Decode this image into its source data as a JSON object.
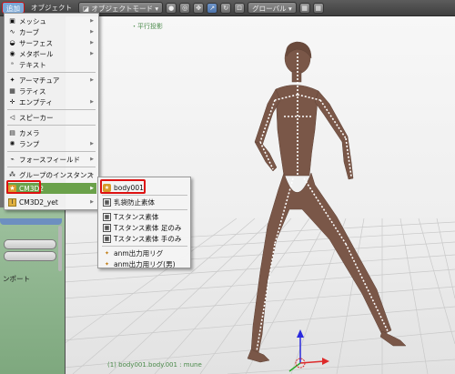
{
  "header": {
    "add_menu": "追加",
    "object_menu": "オブジェクト",
    "mode_select": "オブジェクトモード",
    "orientation_select": "グローバル"
  },
  "viewport": {
    "label": "・平行投影",
    "footer": "(1) body001.body.001 : mune",
    "colors": {
      "background": "#efefef",
      "grid": "#c8c8c8",
      "body": "#7a5748",
      "bone": "#ffffff"
    }
  },
  "shelf": {
    "partial_label": "ンポート"
  },
  "add_menu": {
    "items": [
      {
        "label": "メッシュ",
        "icon": "mesh-icon",
        "submenu": true
      },
      {
        "label": "カーブ",
        "icon": "curve-icon",
        "submenu": true
      },
      {
        "label": "サーフェス",
        "icon": "surface-icon",
        "submenu": true
      },
      {
        "label": "メタボール",
        "icon": "metaball-icon",
        "submenu": true
      },
      {
        "label": "テキスト",
        "icon": "text-icon",
        "submenu": false
      },
      {
        "label": "アーマチュア",
        "icon": "armature-icon",
        "submenu": true
      },
      {
        "label": "ラティス",
        "icon": "lattice-icon",
        "submenu": false
      },
      {
        "label": "エンプティ",
        "icon": "empty-icon",
        "submenu": true
      },
      {
        "label": "スピーカー",
        "icon": "speaker-icon",
        "submenu": false
      },
      {
        "label": "カメラ",
        "icon": "camera-icon",
        "submenu": false
      },
      {
        "label": "ランプ",
        "icon": "lamp-icon",
        "submenu": true
      },
      {
        "label": "フォースフィールド",
        "icon": "force-field-icon",
        "submenu": true
      },
      {
        "label": "グループのインスタンス",
        "icon": "group-instance-icon",
        "submenu": true
      },
      {
        "label": "CM3D2",
        "icon": "cm3d2-icon",
        "submenu": true
      },
      {
        "label": "CM3D2_yet",
        "icon": "cm3d2-yet-icon",
        "submenu": true
      }
    ]
  },
  "cm3d2_submenu": {
    "items": [
      {
        "label": "body001",
        "icon": "body-icon"
      },
      {
        "label": "乳袋防止素体",
        "icon": "mesh-body-icon"
      },
      {
        "label": "Tスタンス素体",
        "icon": "mesh-body-icon"
      },
      {
        "label": "Tスタンス素体 足のみ",
        "icon": "mesh-body-icon"
      },
      {
        "label": "Tスタンス素体 手のみ",
        "icon": "mesh-body-icon"
      },
      {
        "label": "anm出力用リグ",
        "icon": "rig-icon"
      },
      {
        "label": "anm出力用リグ(男)",
        "icon": "rig-icon"
      }
    ]
  }
}
